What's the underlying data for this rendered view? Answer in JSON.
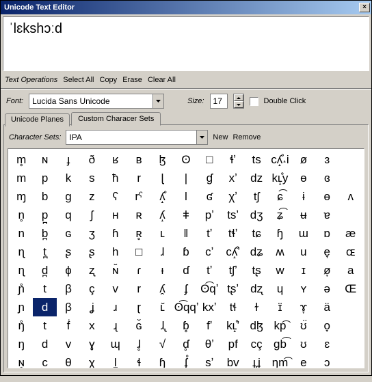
{
  "title": "Unicode Text Editor",
  "editor_text": "ˈlɛkshɔːd",
  "ops": {
    "label": "Text Operations",
    "select_all": "Select All",
    "copy": "Copy",
    "erase": "Erase",
    "clear_all": "Clear All"
  },
  "font": {
    "label": "Font:",
    "value": "Lucida Sans Unicode",
    "size_label": "Size:",
    "size_value": "17",
    "dblclick": "Double Click"
  },
  "tabs": {
    "planes": "Unicode Planes",
    "custom": "Custom Characer Sets"
  },
  "charset": {
    "label": "Character Sets:",
    "value": "IPA",
    "new": "New",
    "remove": "Remove"
  },
  "selected": {
    "row": 8,
    "col": 1
  },
  "grid": [
    [
      "m̥",
      "ɴ",
      "ɟ",
      "ð",
      "ʁ",
      "ʙ",
      "ɮ",
      "ʘ",
      "□",
      "ɬʼ",
      "ts",
      "cʎ̝̊˔i",
      "ø",
      "ɜ"
    ],
    [
      "m",
      "p",
      "k",
      "s",
      "ħ",
      "r",
      "ɭ",
      "|",
      "ɠ",
      "xʼ",
      "dz",
      "kʟ̝̊y",
      "ɵ",
      "ɞ"
    ],
    [
      "ɱ",
      "b",
      "g",
      "z",
      "ʕ",
      "rˤ",
      "ʎ̝̊",
      "ǀ",
      "ʛ",
      "χʼ",
      "tʃ",
      "ɕ͡",
      "ɨ",
      "ɵ",
      "ʌ"
    ],
    [
      "n̥",
      "p̪",
      "q",
      "ʃ",
      "ʜ",
      "ʀ",
      "ʎ̝",
      "ǂ",
      "pʼ",
      "tsʼ",
      "dʒ",
      "ʑ͡",
      "ʉ",
      "ɐ"
    ],
    [
      "n",
      "b̪",
      "ɢ",
      "ʒ",
      "ɦ",
      "ʀ̥",
      "ʟ",
      "‖",
      "tʼ",
      "tɬʼ",
      "tɕ",
      "ɧ",
      "ɯ",
      "ɒ",
      "æ"
    ],
    [
      "ɳ",
      "t̪",
      "ʂ",
      "ʂ",
      "h",
      "□",
      "ɺ",
      "ɓ",
      "cʼ",
      "cʎ̝̊ʼ",
      "dʑ",
      "ʍ",
      "u",
      "e̞",
      "ɶ"
    ],
    [
      "ɳ",
      "d̪",
      "ɸ",
      "ʐ",
      "ɴ̆",
      "ɾ",
      "ᵼ",
      "ɗ",
      "tʼ",
      "tʃʼ",
      "tʂ",
      "w",
      "ɪ",
      "ø̞",
      "a"
    ],
    [
      "ɲ̊",
      "t",
      "β",
      "ç",
      "v",
      "r",
      "ʎ̯",
      "ʄ",
      "ʘ͡qʼ",
      "tʂʼ",
      "dʐ",
      "ɥ",
      "ʏ",
      "ə",
      "Œ"
    ],
    [
      "ɲ",
      "d",
      "β",
      "ʝ",
      "ɹ",
      "ɽ",
      "ʟ̆",
      "ʘ͡qqʼ",
      "kxʼ",
      "tɬ",
      "ɫ",
      "ɪ̈",
      "ɤ̞",
      "ä"
    ],
    [
      "ŋ̊",
      "t",
      "ḟ",
      "x",
      "ɻ",
      "ɢ̆",
      "ɺ̢",
      "ɓ̥",
      "fʼ",
      "kʟ̝̊ʼ",
      "dɮ",
      "kp͡",
      "ʊ̈",
      "o̞",
      ""
    ],
    [
      "ŋ",
      "d",
      "v",
      "ɣ",
      "ɰ",
      "ɺ̥",
      "√",
      "ɗ̥",
      "θʼ",
      "pf",
      "cç",
      "gb͡",
      "ʊ",
      "ɛ",
      ""
    ],
    [
      "ɴ̥",
      "c",
      "θ",
      "χ",
      "l̪",
      "ɬ",
      "ɧ",
      "ʄ̊",
      "sʼ",
      "bv",
      "ɟʝ",
      "ŋm͡",
      "e",
      "ɔ",
      ""
    ]
  ]
}
